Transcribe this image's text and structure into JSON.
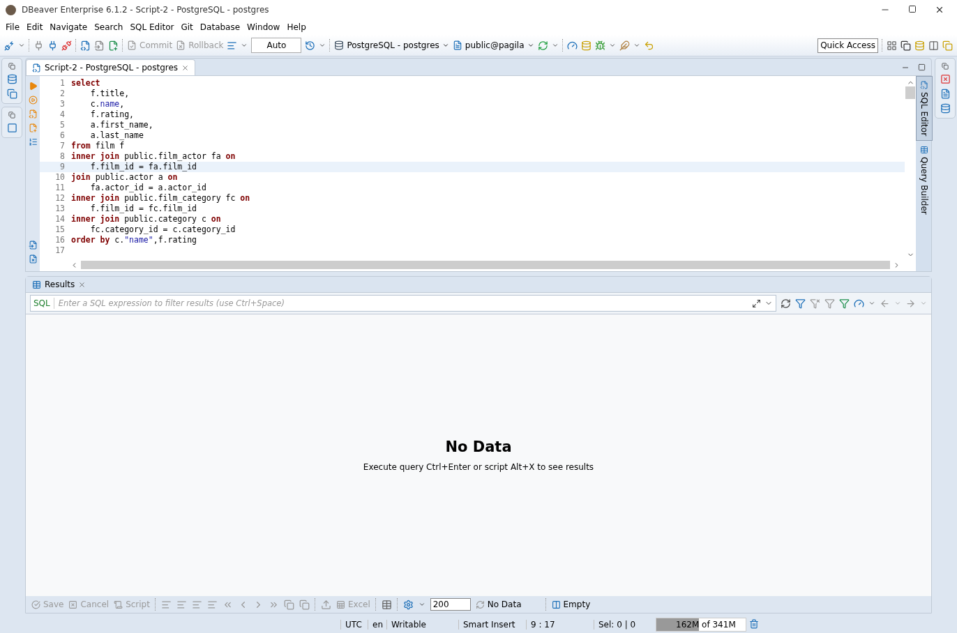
{
  "window": {
    "title": "DBeaver Enterprise 6.1.2 - Script-2 - PostgreSQL - postgres"
  },
  "menu": [
    "File",
    "Edit",
    "Navigate",
    "Search",
    "SQL Editor",
    "Git",
    "Database",
    "Window",
    "Help"
  ],
  "toolbar": {
    "commit": {
      "label": "Commit",
      "disabled": true
    },
    "rollback": {
      "label": "Rollback",
      "disabled": true
    },
    "transaction_mode": "Auto",
    "connection": "PostgreSQL - postgres",
    "schema": "public@pagila",
    "quick_access": "Quick Access"
  },
  "editor_tab": {
    "title": "Script-2 - PostgreSQL - postgres",
    "selected": true
  },
  "editor": {
    "lines": [
      {
        "number": "1",
        "current": false,
        "tokens": [
          {
            "text": "select",
            "kind": "keyword"
          }
        ]
      },
      {
        "number": "2",
        "current": false,
        "tokens": [
          {
            "text": "    f.title,",
            "kind": "plain"
          }
        ]
      },
      {
        "number": "3",
        "current": false,
        "tokens": [
          {
            "text": "    c.",
            "kind": "plain"
          },
          {
            "text": "name",
            "kind": "identifier"
          },
          {
            "text": ",",
            "kind": "plain"
          }
        ]
      },
      {
        "number": "4",
        "current": false,
        "tokens": [
          {
            "text": "    f.rating,",
            "kind": "plain"
          }
        ]
      },
      {
        "number": "5",
        "current": false,
        "tokens": [
          {
            "text": "    a.first_name,",
            "kind": "plain"
          }
        ]
      },
      {
        "number": "6",
        "current": false,
        "tokens": [
          {
            "text": "    a.last_name",
            "kind": "plain"
          }
        ]
      },
      {
        "number": "7",
        "current": false,
        "tokens": [
          {
            "text": "from",
            "kind": "keyword"
          },
          {
            "text": " film f",
            "kind": "plain"
          }
        ]
      },
      {
        "number": "8",
        "current": false,
        "tokens": [
          {
            "text": "inner join",
            "kind": "keyword"
          },
          {
            "text": " public.film_actor fa ",
            "kind": "plain"
          },
          {
            "text": "on",
            "kind": "keyword"
          }
        ]
      },
      {
        "number": "9",
        "current": true,
        "tokens": [
          {
            "text": "    f.film_id = fa.film_id",
            "kind": "plain"
          }
        ]
      },
      {
        "number": "10",
        "current": false,
        "tokens": [
          {
            "text": "join",
            "kind": "keyword"
          },
          {
            "text": " public.actor a ",
            "kind": "plain"
          },
          {
            "text": "on",
            "kind": "keyword"
          }
        ]
      },
      {
        "number": "11",
        "current": false,
        "tokens": [
          {
            "text": "    fa.actor_id = a.actor_id",
            "kind": "plain"
          }
        ]
      },
      {
        "number": "12",
        "current": false,
        "tokens": [
          {
            "text": "inner join",
            "kind": "keyword"
          },
          {
            "text": " public.film_category fc ",
            "kind": "plain"
          },
          {
            "text": "on",
            "kind": "keyword"
          }
        ]
      },
      {
        "number": "13",
        "current": false,
        "tokens": [
          {
            "text": "    f.film_id = fc.film_id",
            "kind": "plain"
          }
        ]
      },
      {
        "number": "14",
        "current": false,
        "tokens": [
          {
            "text": "inner join",
            "kind": "keyword"
          },
          {
            "text": " public.category c ",
            "kind": "plain"
          },
          {
            "text": "on",
            "kind": "keyword"
          }
        ]
      },
      {
        "number": "15",
        "current": false,
        "tokens": [
          {
            "text": "    fc.category_id = c.category_id",
            "kind": "plain"
          }
        ]
      },
      {
        "number": "16",
        "current": false,
        "tokens": [
          {
            "text": "order by",
            "kind": "keyword"
          },
          {
            "text": " c.",
            "kind": "plain"
          },
          {
            "text": "\"name\"",
            "kind": "identifier"
          },
          {
            "text": ",f.rating",
            "kind": "plain"
          }
        ]
      },
      {
        "number": "17",
        "current": false
      }
    ]
  },
  "side_tabs": [
    {
      "label": "SQL Editor",
      "selected": true
    },
    {
      "label": "Query Builder",
      "selected": false
    }
  ],
  "results": {
    "tab": "Results",
    "filter_label": "SQL",
    "filter_placeholder": "Enter a SQL expression to filter results (use Ctrl+Space)",
    "empty_title": "No Data",
    "empty_hint": "Execute query Ctrl+Enter or script Alt+X to see results",
    "actions": [
      {
        "label": "Save",
        "disabled": true
      },
      {
        "label": "Cancel",
        "disabled": true
      },
      {
        "label": "Script",
        "disabled": true
      }
    ],
    "export": {
      "label": "Excel",
      "disabled": true
    },
    "fetch_size": "200",
    "refresh_status": "No Data",
    "panel_status": "Empty"
  },
  "status_bar": {
    "timezone": "UTC",
    "locale": "en",
    "mode": "Writable",
    "insert_mode": "Smart Insert",
    "position": "9 : 17",
    "selection": "Sel: 0 | 0",
    "memory": {
      "used": "162M",
      "total": "of 341M",
      "level": 0.475
    }
  }
}
